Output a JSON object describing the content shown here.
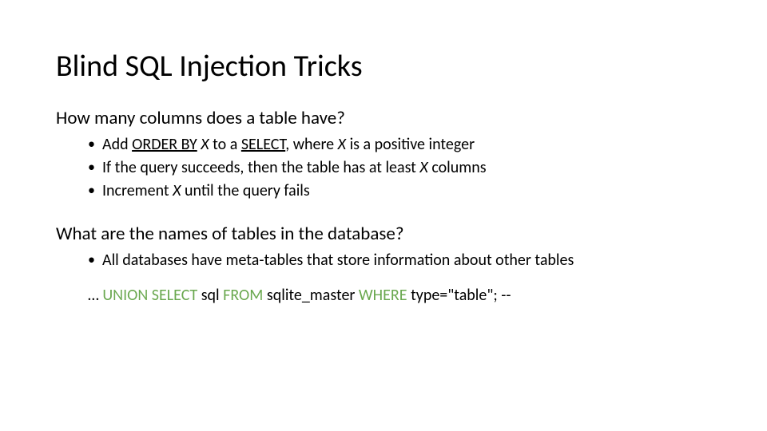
{
  "title": "Blind SQL Injection Tricks",
  "section1": {
    "heading": "How many columns does a table have?",
    "bullets": {
      "b1_a": "Add ",
      "b1_b": "ORDER BY",
      "b1_c": " X",
      "b1_d": " to a ",
      "b1_e": "SELECT",
      "b1_f": ", where ",
      "b1_g": "X",
      "b1_h": " is a positive integer",
      "b2_a": "If the query succeeds, then the table has at least ",
      "b2_b": "X",
      "b2_c": " columns",
      "b3_a": "Increment ",
      "b3_b": "X",
      "b3_c": " until the query fails"
    }
  },
  "section2": {
    "heading": "What are the names of tables in the database?",
    "bullet": "All databases have meta-tables that store information about other tables"
  },
  "sql": {
    "ellipsis": "… ",
    "kw1": "UNION SELECT",
    "t1": " sql ",
    "kw2": "FROM",
    "t2": " sqlite_master ",
    "kw3": "WHERE",
    "t3": " type=\"table\"; --"
  }
}
